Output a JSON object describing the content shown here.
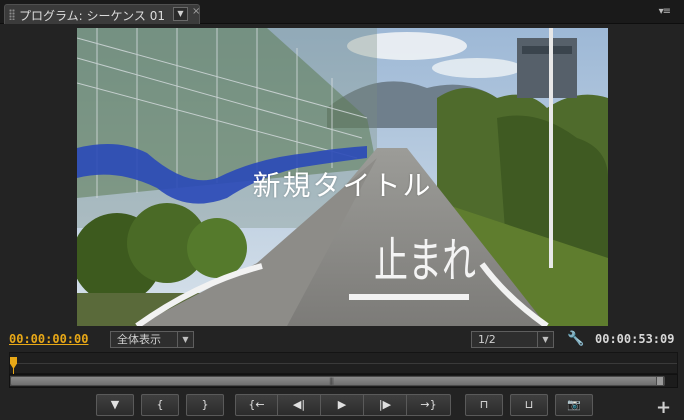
{
  "panel": {
    "tab_title": "プログラム: シーケンス 01",
    "tab_menu_glyph": "▼",
    "close_glyph": "×",
    "panel_menu_glyph": "▾≡"
  },
  "video": {
    "title_overlay": "新規タイトル",
    "road_marking": "止まれ"
  },
  "controls": {
    "current_timecode": "00:00:00:00",
    "zoom_select": "全体表示",
    "resolution_select": "1/2",
    "select_arrow": "▼",
    "wrench_glyph": "🔧",
    "duration_timecode": "00:00:53:09"
  },
  "scrollbar": {
    "grip": "|||"
  },
  "transport": [
    {
      "name": "add-marker-button",
      "glyph": "▼",
      "icon": "marker-icon"
    },
    {
      "name": "mark-in-button",
      "glyph": "{",
      "icon": "mark-in-icon"
    },
    {
      "name": "mark-out-button",
      "glyph": "}",
      "icon": "mark-out-icon"
    },
    {
      "name": "go-to-in-button",
      "glyph": "{←",
      "icon": "go-to-in-icon"
    },
    {
      "name": "step-back-button",
      "glyph": "◀|",
      "icon": "step-back-icon"
    },
    {
      "name": "play-button",
      "glyph": "▶",
      "icon": "play-icon"
    },
    {
      "name": "step-forward-button",
      "glyph": "|▶",
      "icon": "step-forward-icon"
    },
    {
      "name": "go-to-out-button",
      "glyph": "→}",
      "icon": "go-to-out-icon"
    },
    {
      "name": "lift-button",
      "glyph": "⊓",
      "icon": "lift-icon"
    },
    {
      "name": "extract-button",
      "glyph": "⊔",
      "icon": "extract-icon"
    },
    {
      "name": "export-frame-button",
      "glyph": "📷",
      "icon": "camera-icon"
    }
  ],
  "add_button": "+",
  "colors": {
    "accent": "#e8a817",
    "panel_bg": "#232323"
  }
}
